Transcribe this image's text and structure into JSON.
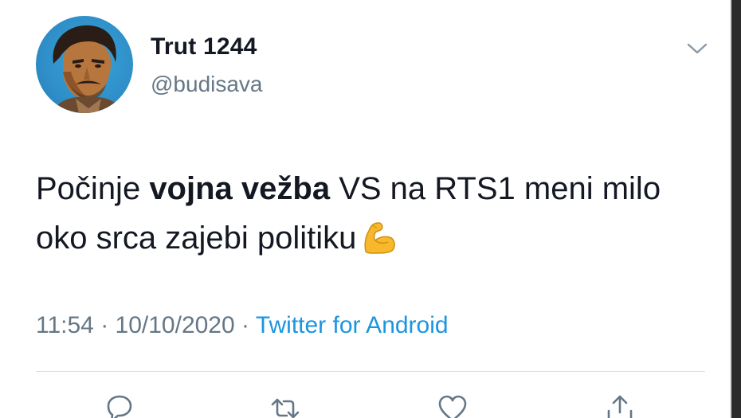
{
  "tweet": {
    "author": {
      "name": "Trut 1244",
      "handle": "@budisava"
    },
    "text": {
      "part1": "Počinje ",
      "bold": "vojna vežba",
      "part2": " VS na RTS1 meni milo oko srca zajebi politiku",
      "emoji": "flexed-biceps-emoji"
    },
    "time": "11:54",
    "separator": " · ",
    "date": "10/10/2020",
    "source": "Twitter for Android"
  },
  "icons": {
    "menu": "chevron-down-icon",
    "reply": "reply-icon",
    "retweet": "retweet-icon",
    "like": "heart-icon",
    "share": "share-icon"
  },
  "colors": {
    "text": "#141823",
    "secondary": "#657786",
    "link": "#1b95e0",
    "avatar_background": "#2f8fc9"
  }
}
